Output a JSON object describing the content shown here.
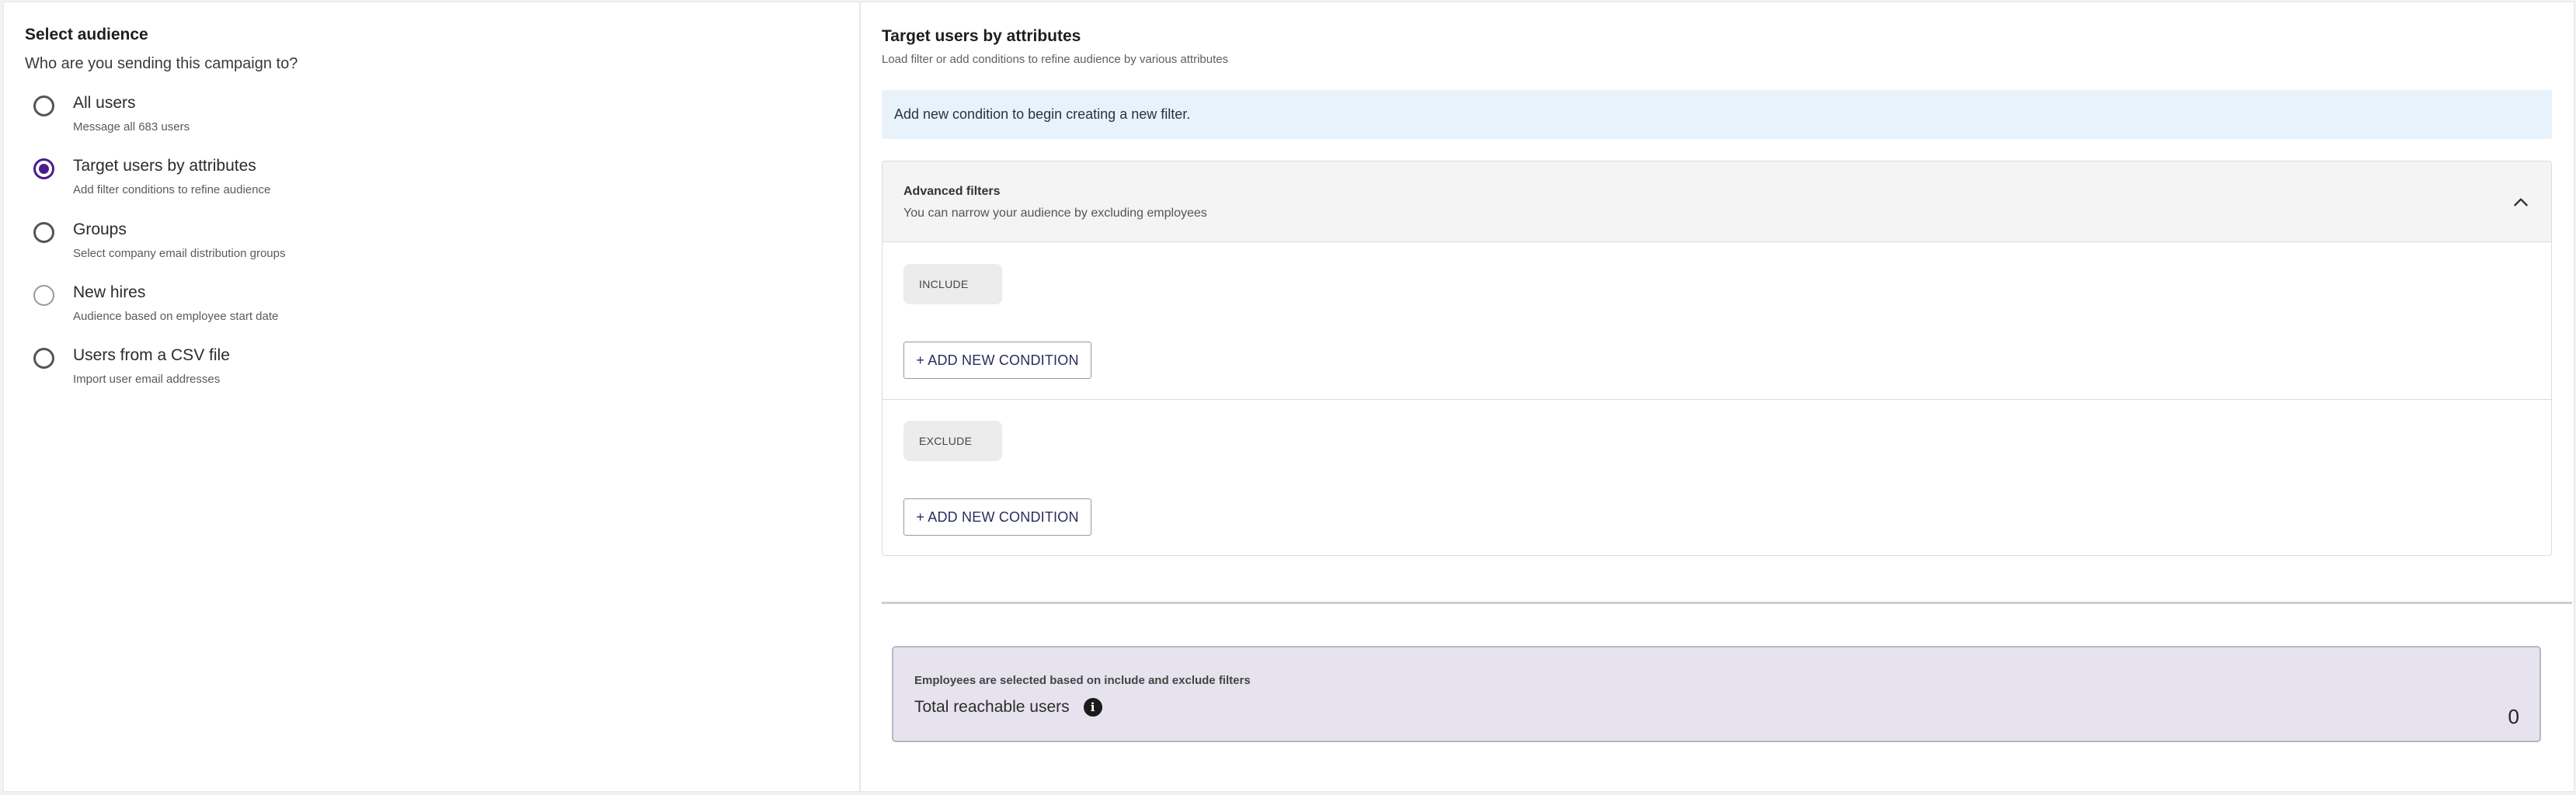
{
  "left": {
    "title": "Select audience",
    "question": "Who are you sending this campaign to?",
    "options": [
      {
        "label": "All users",
        "sub": "Message all 683 users",
        "selected": false
      },
      {
        "label": "Target users by attributes",
        "sub": "Add filter conditions to refine audience",
        "selected": true
      },
      {
        "label": "Groups",
        "sub": "Select company email distribution groups",
        "selected": false
      },
      {
        "label": "New hires",
        "sub": "Audience based on employee start date",
        "selected": false
      },
      {
        "label": "Users from a CSV file",
        "sub": "Import user email addresses",
        "selected": false
      }
    ]
  },
  "right": {
    "title": "Target users by attributes",
    "subtitle": "Load filter or add conditions to refine audience by various attributes",
    "banner": "Add new condition to begin creating a new filter.",
    "advanced": {
      "title": "Advanced filters",
      "subtitle": "You can narrow your audience by excluding employees",
      "toggle_icon": "chevron-up-icon"
    },
    "include": {
      "chip": "INCLUDE",
      "button": "+ ADD NEW CONDITION"
    },
    "exclude": {
      "chip": "EXCLUDE",
      "button": "+ ADD NEW CONDITION"
    },
    "reach": {
      "note": "Employees are selected based on include and exclude filters",
      "label": "Total reachable users",
      "info_icon": "info-icon",
      "count": "0"
    }
  },
  "colors": {
    "accent": "#4b1d8a",
    "banner_bg": "#e8f2fb",
    "reach_bg": "#e6e3ee"
  }
}
